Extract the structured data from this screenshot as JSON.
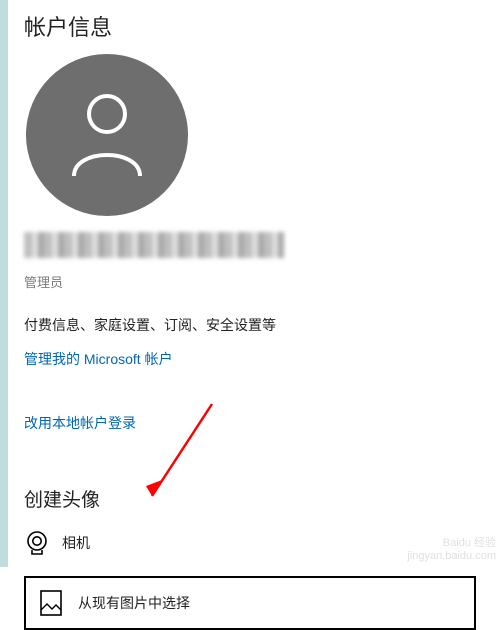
{
  "header": {
    "title": "帐户信息"
  },
  "account": {
    "role": "管理员",
    "description": "付费信息、家庭设置、订阅、安全设置等",
    "manageLink": "管理我的 Microsoft 帐户",
    "localLoginLink": "改用本地帐户登录"
  },
  "avatarSection": {
    "title": "创建头像",
    "cameraLabel": "相机",
    "browseLabel": "从现有图片中选择"
  },
  "watermark": {
    "line1": "Baidu 经验",
    "line2": "jingyan.baidu.com"
  }
}
